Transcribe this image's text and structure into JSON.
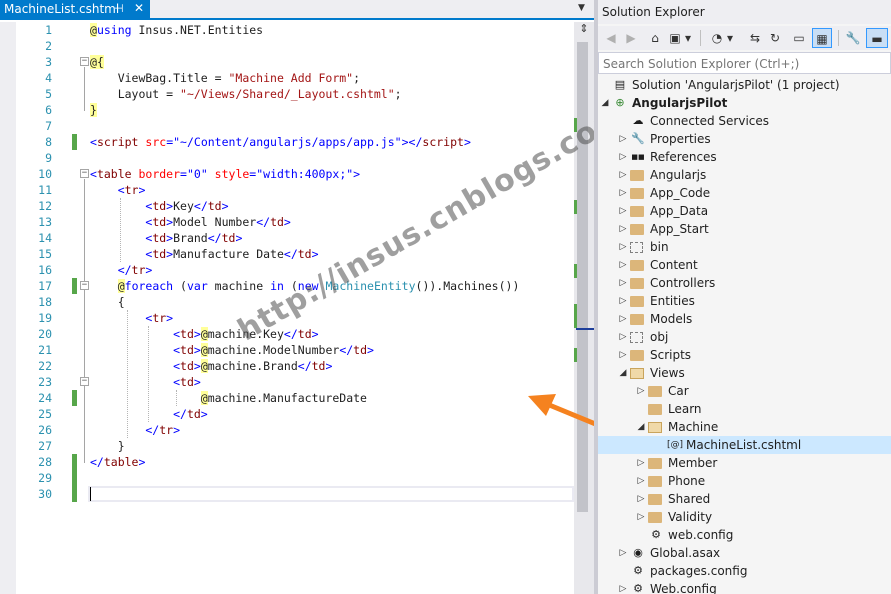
{
  "editor": {
    "tab_title": "MachineList.cshtml",
    "tab_pin": "⊣",
    "tab_close": "✕",
    "tab_dropdown": "▼",
    "split_button": "⇕",
    "watermark": "http://insus.cnblogs.com",
    "line_numbers": [
      "1",
      "2",
      "3",
      "4",
      "5",
      "6",
      "7",
      "8",
      "9",
      "10",
      "11",
      "12",
      "13",
      "14",
      "15",
      "16",
      "17",
      "18",
      "19",
      "20",
      "21",
      "22",
      "23",
      "24",
      "25",
      "26",
      "27",
      "28",
      "29",
      "30"
    ],
    "code": {
      "l1a": "@",
      "l1b": "using",
      "l1c": " Insus.NET.Entities",
      "l3a": "@{",
      "l4a": "    ViewBag.Title = ",
      "l4b": "\"Machine Add Form\"",
      "l4c": ";",
      "l5a": "    Layout = ",
      "l5b": "\"~/Views/Shared/_Layout.cshtml\"",
      "l5c": ";",
      "l6a": "}",
      "l8a": "<",
      "l8b": "script",
      "l8c": " src",
      "l8d": "=",
      "l8e": "\"~/Content/angularjs/apps/app.js\"",
      "l8f": "></",
      "l8g": "script",
      "l8h": ">",
      "l10a": "<",
      "l10b": "table",
      "l10c": " border",
      "l10d": "=",
      "l10e": "\"0\"",
      "l10f": " style",
      "l10g": "=",
      "l10h": "\"width:400px;\"",
      "l10i": ">",
      "l11a": "    <",
      "l11b": "tr",
      "l11c": ">",
      "l12a": "        <",
      "l12b": "td",
      "l12c": ">",
      "l12d": "Key",
      "l12e": "</",
      "l12f": "td",
      "l12g": ">",
      "l13a": "        <",
      "l13b": "td",
      "l13c": ">",
      "l13d": "Model Number",
      "l13e": "</",
      "l13f": "td",
      "l13g": ">",
      "l14a": "        <",
      "l14b": "td",
      "l14c": ">",
      "l14d": "Brand",
      "l14e": "</",
      "l14f": "td",
      "l14g": ">",
      "l15a": "        <",
      "l15b": "td",
      "l15c": ">",
      "l15d": "Manufacture Date",
      "l15e": "</",
      "l15f": "td",
      "l15g": ">",
      "l16a": "    </",
      "l16b": "tr",
      "l16c": ">",
      "l17a": "    ",
      "l17b": "@",
      "l17c": "foreach",
      "l17d": " (",
      "l17e": "var",
      "l17f": " machine ",
      "l17g": "in",
      "l17h": " (",
      "l17i": "new",
      "l17j": " ",
      "l17k": "MachineEntity",
      "l17l": "()).Machines())",
      "l18a": "    {",
      "l19a": "        <",
      "l19b": "tr",
      "l19c": ">",
      "l20a": "            <",
      "l20b": "td",
      "l20c": ">",
      "l20d": "@",
      "l20e": "machine.Key",
      "l20f": "</",
      "l20g": "td",
      "l20h": ">",
      "l21a": "            <",
      "l21b": "td",
      "l21c": ">",
      "l21d": "@",
      "l21e": "machine.ModelNumber",
      "l21f": "</",
      "l21g": "td",
      "l21h": ">",
      "l22a": "            <",
      "l22b": "td",
      "l22c": ">",
      "l22d": "@",
      "l22e": "machine.Brand",
      "l22f": "</",
      "l22g": "td",
      "l22h": ">",
      "l23a": "            <",
      "l23b": "td",
      "l23c": ">",
      "l24a": "                ",
      "l24b": "@",
      "l24c": "machine.ManufactureDate",
      "l25a": "            </",
      "l25b": "td",
      "l25c": ">",
      "l26a": "        </",
      "l26b": "tr",
      "l26c": ">",
      "l27a": "    }",
      "l28a": "</",
      "l28b": "table",
      "l28c": ">"
    }
  },
  "solution_explorer": {
    "title": "Solution Explorer",
    "search_placeholder": "Search Solution Explorer (Ctrl+;)",
    "toolbar": {
      "back": "◀",
      "forward": "▶",
      "home": "⌂",
      "switch_views": "▣",
      "dropdown": "▾",
      "pending_changes": "◔",
      "sync": "⇆",
      "refresh": "↻",
      "collapse_all": "▭",
      "show_all_files": "▦",
      "properties": "🔧",
      "preview": "▬"
    },
    "tree": [
      {
        "label": "Solution 'AngularjsPilot' (1 project)",
        "icon": "solution-icon",
        "bold": false
      },
      {
        "label": "AngularjsPilot",
        "icon": "web-project-icon",
        "bold": true
      },
      {
        "label": "Connected Services",
        "icon": "cloud-icon",
        "bold": false
      },
      {
        "label": "Properties",
        "icon": "wrench-icon",
        "bold": false
      },
      {
        "label": "References",
        "icon": "references-icon",
        "bold": false
      },
      {
        "label": "Angularjs",
        "icon": "folder-icon",
        "bold": false
      },
      {
        "label": "App_Code",
        "icon": "folder-icon",
        "bold": false
      },
      {
        "label": "App_Data",
        "icon": "folder-icon",
        "bold": false
      },
      {
        "label": "App_Start",
        "icon": "folder-icon",
        "bold": false
      },
      {
        "label": "bin",
        "icon": "dashed-folder-icon",
        "bold": false
      },
      {
        "label": "Content",
        "icon": "folder-icon",
        "bold": false
      },
      {
        "label": "Controllers",
        "icon": "folder-icon",
        "bold": false
      },
      {
        "label": "Entities",
        "icon": "folder-icon",
        "bold": false
      },
      {
        "label": "Models",
        "icon": "folder-icon",
        "bold": false
      },
      {
        "label": "obj",
        "icon": "dashed-folder-icon",
        "bold": false
      },
      {
        "label": "Scripts",
        "icon": "folder-icon",
        "bold": false
      },
      {
        "label": "Views",
        "icon": "open-folder-icon",
        "bold": false
      },
      {
        "label": "Car",
        "icon": "folder-icon",
        "bold": false
      },
      {
        "label": "Learn",
        "icon": "folder-icon",
        "bold": false
      },
      {
        "label": "Machine",
        "icon": "open-folder-icon",
        "bold": false
      },
      {
        "label": "MachineList.cshtml",
        "icon": "razor-file-icon",
        "bold": false
      },
      {
        "label": "Member",
        "icon": "folder-icon",
        "bold": false
      },
      {
        "label": "Phone",
        "icon": "folder-icon",
        "bold": false
      },
      {
        "label": "Shared",
        "icon": "folder-icon",
        "bold": false
      },
      {
        "label": "Validity",
        "icon": "folder-icon",
        "bold": false
      },
      {
        "label": "web.config",
        "icon": "config-file-icon",
        "bold": false
      },
      {
        "label": "Global.asax",
        "icon": "global-asax-icon",
        "bold": false
      },
      {
        "label": "packages.config",
        "icon": "config-file-icon",
        "bold": false
      },
      {
        "label": "Web.config",
        "icon": "config-file-icon",
        "bold": false
      }
    ],
    "glyphs": {
      "collapsed": "▷",
      "expanded": "◢",
      "cloud": "☁",
      "wrench": "🔧",
      "references": "■■",
      "razor": "[@]",
      "config": "⚙",
      "global": "◉",
      "solution": "▤",
      "project": "⊕"
    }
  },
  "colors": {
    "accent": "#007acc",
    "line_number": "#2b91af",
    "keyword": "#0000ff",
    "tag": "#800000",
    "attribute": "#ff0000",
    "string": "#a31515",
    "type": "#2b91af",
    "razor_highlight": "#ffff99",
    "changed_line": "#57a64a",
    "selection": "#cce8ff",
    "arrow": "#f5821f"
  }
}
